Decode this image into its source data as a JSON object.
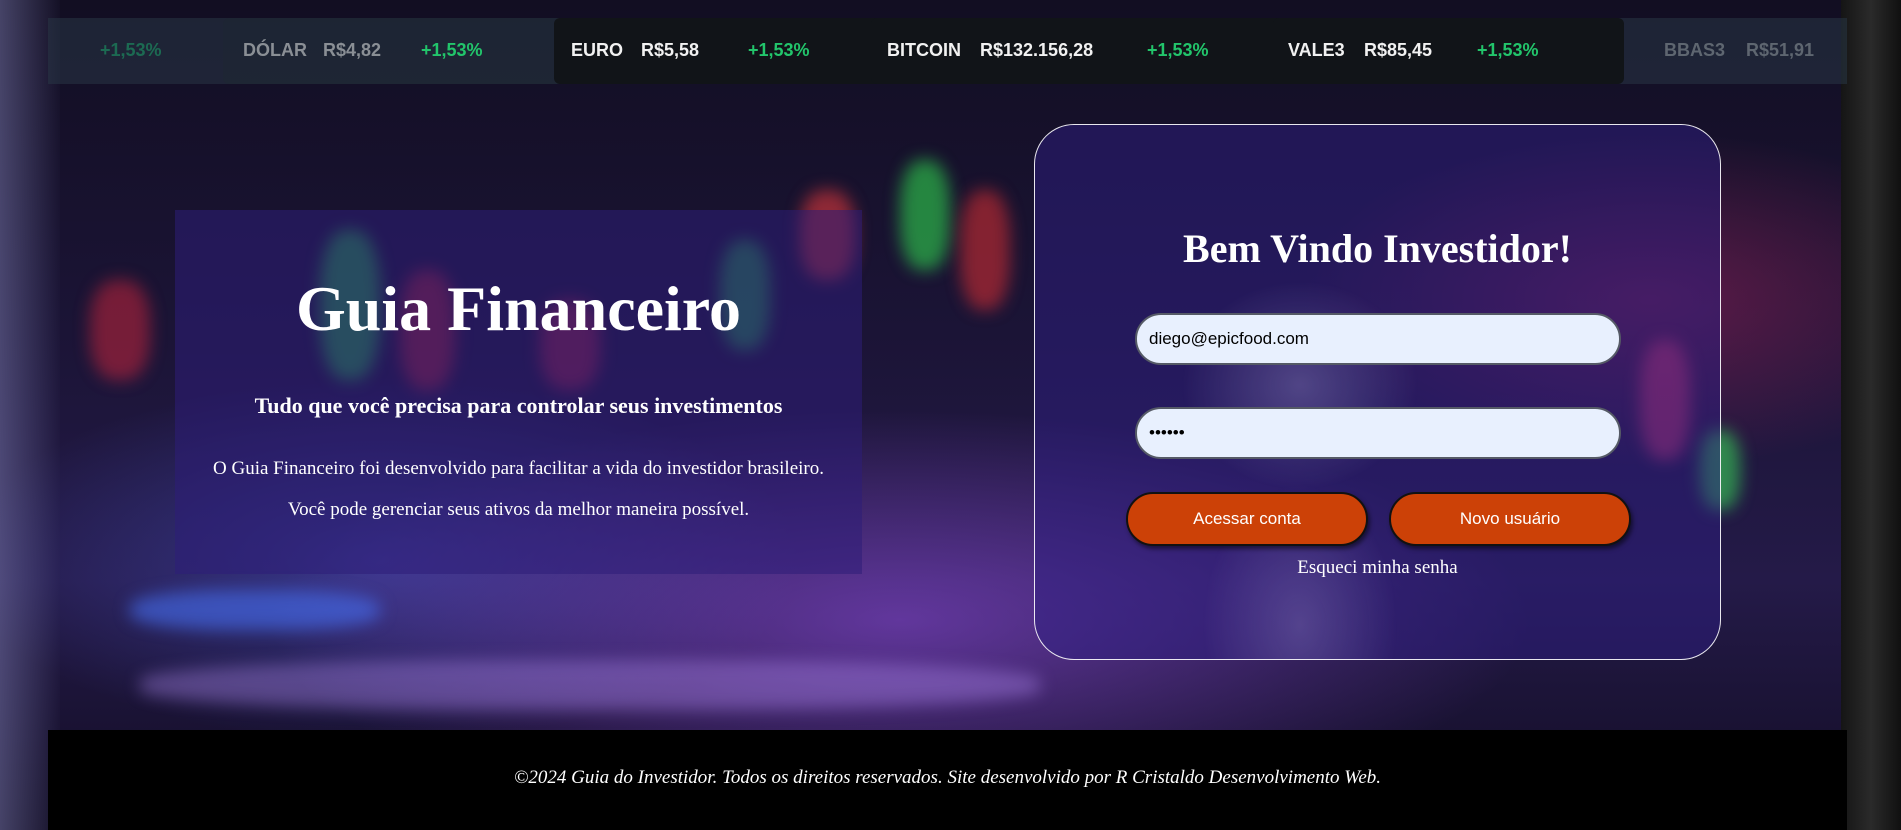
{
  "ticker": {
    "items": [
      {
        "change": "+1,53%"
      },
      {
        "name": "DÓLAR",
        "price": "R$4,82",
        "change": "+1,53%"
      },
      {
        "name": "EURO",
        "price": "R$5,58",
        "change": "+1,53%"
      },
      {
        "name": "BITCOIN",
        "price": "R$132.156,28",
        "change": "+1,53%"
      },
      {
        "name": "VALE3",
        "price": "R$85,45",
        "change": "+1,53%"
      },
      {
        "name": "BBAS3",
        "price": "R$51,91"
      }
    ]
  },
  "intro": {
    "title": "Guia Financeiro",
    "subtitle": "Tudo que você precisa para controlar seus investimentos",
    "line1": "O Guia Financeiro foi desenvolvido para facilitar a vida do investidor brasileiro.",
    "line2": "Você pode gerenciar seus ativos da melhor maneira possível."
  },
  "login": {
    "heading": "Bem Vindo Investidor!",
    "email_value": "diego@epicfood.com",
    "password_value": "••••••",
    "login_button": "Acessar conta",
    "new_user_button": "Novo usuário",
    "forgot_link": "Esqueci minha senha"
  },
  "footer": {
    "text": "©2024 Guia do Investidor. Todos os direitos reservados. Site desenvolvido por R Cristaldo Desenvolvimento Web."
  },
  "colors": {
    "positive": "#22c56b",
    "button": "#cc4107",
    "input_bg": "#e8f0fe"
  }
}
